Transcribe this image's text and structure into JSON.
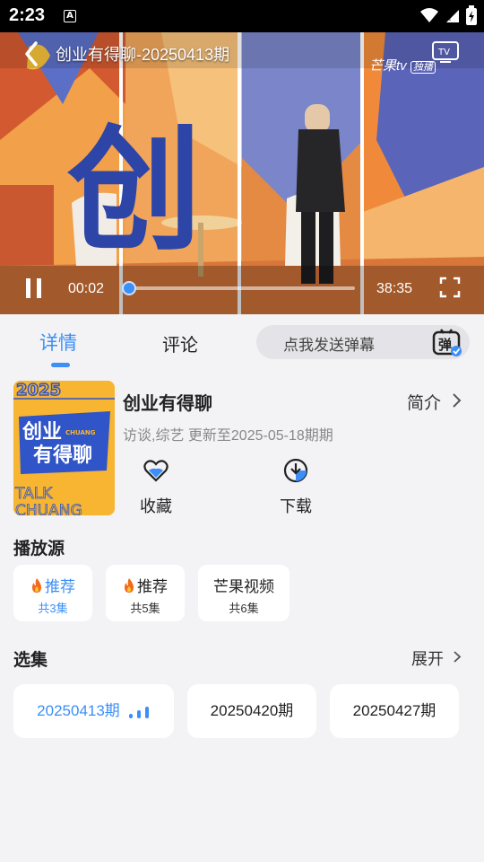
{
  "status_bar": {
    "time": "2:23",
    "notification_letter": "A",
    "icons": [
      "wifi-icon",
      "cell-signal-icon",
      "battery-icon"
    ]
  },
  "player": {
    "title": "创业有得聊-20250413期",
    "overlay_char": "创",
    "brand": "芒果tv",
    "brand_badge": "独播",
    "current_time": "00:02",
    "total_time": "38:35",
    "progress": 0.001,
    "icons": [
      "back-arrow-icon",
      "tv-cast-icon",
      "pause-icon",
      "fullscreen-icon"
    ]
  },
  "tabs": {
    "detail_label": "详情",
    "comment_label": "评论",
    "danmaku_placeholder": "点我发送弹幕",
    "danmaku_icon_char": "弹"
  },
  "show": {
    "title": "创业有得聊",
    "intro_label": "简介",
    "meta": "访谈,综艺 更新至2025-05-18期期",
    "poster_text": {
      "year": "2025",
      "title_line1": "创业",
      "title_line2": "有得聊",
      "chuang": "CHUANG",
      "talk": "TALK",
      "chuang2": "CHUANG"
    },
    "favorite_label": "收藏",
    "download_label": "下载"
  },
  "sources": {
    "title": "播放源",
    "items": [
      {
        "name": "推荐",
        "count": "共3集",
        "active": true,
        "hot": true
      },
      {
        "name": "推荐",
        "count": "共5集",
        "active": false,
        "hot": true
      },
      {
        "name": "芒果视频",
        "count": "共6集",
        "active": false,
        "hot": false
      }
    ]
  },
  "episodes": {
    "title": "选集",
    "expand_label": "展开",
    "items": [
      {
        "label": "20250413期",
        "playing": true
      },
      {
        "label": "20250420期",
        "playing": false
      },
      {
        "label": "20250427期",
        "playing": false
      }
    ]
  },
  "colors": {
    "accent": "#3b8ff7",
    "background": "#f3f3f5",
    "card": "#ffffff",
    "poster_yellow": "#f7b532"
  }
}
